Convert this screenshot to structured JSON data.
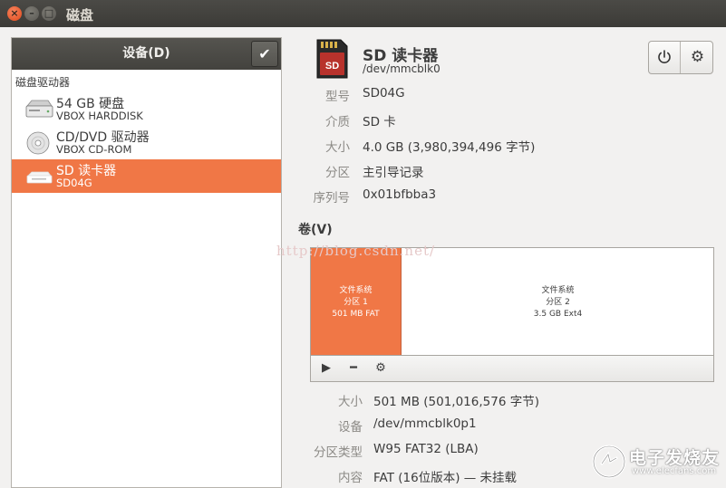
{
  "window": {
    "title": "磁盘"
  },
  "sidebar": {
    "header": "设备(D)",
    "section_label": "磁盘驱动器",
    "drives": [
      {
        "name": "54 GB 硬盘",
        "sub": "VBOX HARDDISK",
        "icon": "harddisk-icon"
      },
      {
        "name": "CD/DVD 驱动器",
        "sub": "VBOX CD-ROM",
        "icon": "optical-disc-icon"
      },
      {
        "name": "SD 读卡器",
        "sub": "SD04G",
        "icon": "card-reader-icon",
        "selected": true
      }
    ]
  },
  "device": {
    "name": "SD 读卡器",
    "path": "/dev/mmcblk0",
    "props": [
      {
        "label": "型号",
        "value": "SD04G"
      },
      {
        "label": "介质",
        "value": "SD 卡"
      },
      {
        "label": "大小",
        "value": "4.0 GB (3,980,394,496 字节)"
      },
      {
        "label": "分区",
        "value": "主引导记录"
      },
      {
        "label": "序列号",
        "value": "0x01bfbba3"
      }
    ]
  },
  "volumes": {
    "heading": "卷(V)",
    "watermark": "http://blog.csdn.net/",
    "partitions": [
      {
        "line1": "文件系统",
        "line2": "分区 1",
        "line3": "501 MB FAT",
        "selected": true
      },
      {
        "line1": "文件系统",
        "line2": "分区 2",
        "line3": "3.5 GB Ext4"
      }
    ],
    "props": [
      {
        "label": "大小",
        "value": "501 MB (501,016,576 字节)"
      },
      {
        "label": "设备",
        "value": "/dev/mmcblk0p1"
      },
      {
        "label": "分区类型",
        "value": "W95 FAT32 (LBA)"
      },
      {
        "label": "内容",
        "value": "FAT (16位版本) — 未挂载"
      }
    ]
  },
  "logo": {
    "text": "电子发烧友",
    "url": "www.elecfans.com"
  },
  "colors": {
    "accent": "#f07746",
    "titlebar": "#3c3b37"
  }
}
